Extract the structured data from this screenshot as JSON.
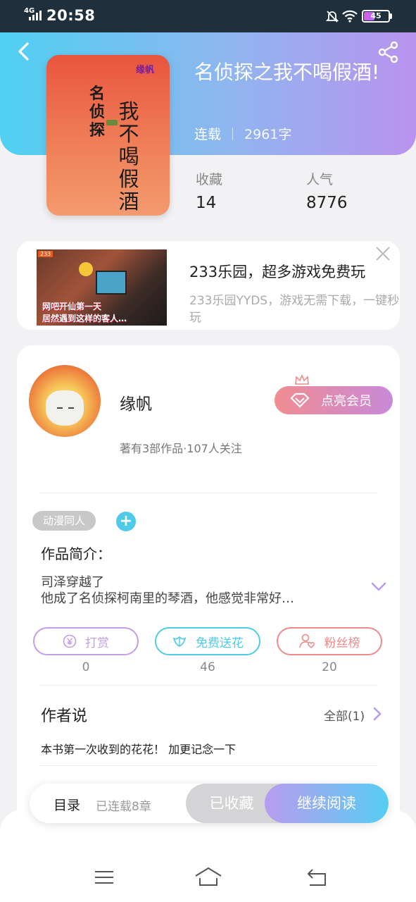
{
  "status_bar": {
    "network": "4G",
    "time": "20:58",
    "battery": "45",
    "battery_level": 0.45
  },
  "book": {
    "title": "名侦探之我不喝假酒!",
    "status": "连载",
    "word_count": "2961字",
    "cover": {
      "tag": "缘帆",
      "col1": "名侦探",
      "col2": "我不喝假酒"
    },
    "stats": [
      {
        "label": "收藏",
        "value": "14"
      },
      {
        "label": "人气",
        "value": "8776"
      }
    ]
  },
  "ad": {
    "badge": "233",
    "image_caption_1": "网吧开仙第一天",
    "image_caption_2": "居然遇到这样的客人…",
    "title": "233乐园，超多游戏免费玩",
    "desc": "233乐园YYDS，游戏无需下载，一键秒玩"
  },
  "author": {
    "name": "缘帆",
    "meta": "著有3部作品·107人关注",
    "vip_label": "点亮会员"
  },
  "tags": [
    "动漫同人"
  ],
  "tag_add": "+",
  "intro": {
    "title": "作品简介：",
    "line1": "司泽穿越了",
    "line2": "他成了名侦探柯南里的琴酒，他感觉非常好…"
  },
  "actions": [
    {
      "label": "打赏",
      "count": "0",
      "icon": "yen-icon",
      "color": "#c59ce6"
    },
    {
      "label": "免费送花",
      "count": "46",
      "icon": "flower-icon",
      "color": "#4fcbe8"
    },
    {
      "label": "粉丝榜",
      "count": "20",
      "icon": "fan-icon",
      "color": "#ee8a8a"
    }
  ],
  "author_says": {
    "title": "作者说",
    "all_label": "全部(1)",
    "text": "本书第一次收到的花花！ 加更记念一下"
  },
  "bottom_bar": {
    "toc_label": "目录",
    "toc_status": "已连载8章",
    "collected_label": "已收藏",
    "read_label": "继续阅读"
  }
}
